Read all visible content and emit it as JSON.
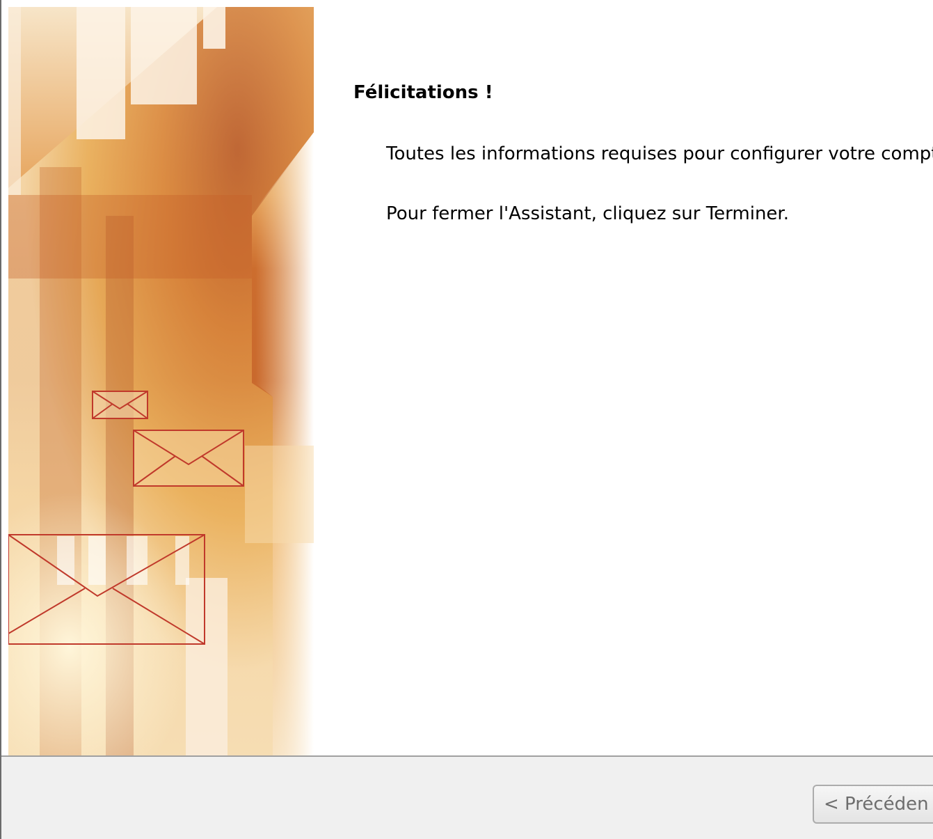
{
  "content": {
    "title": "Félicitations !",
    "paragraph_1": "Toutes les informations requises pour configurer votre compt",
    "paragraph_2": "Pour fermer l'Assistant, cliquez sur Terminer."
  },
  "footer": {
    "prev_button_label": "< Précéden"
  },
  "colors": {
    "banner_orange": "#c8692c",
    "envelope_stroke": "#c0392b",
    "footer_bg": "#f0f0f0"
  }
}
